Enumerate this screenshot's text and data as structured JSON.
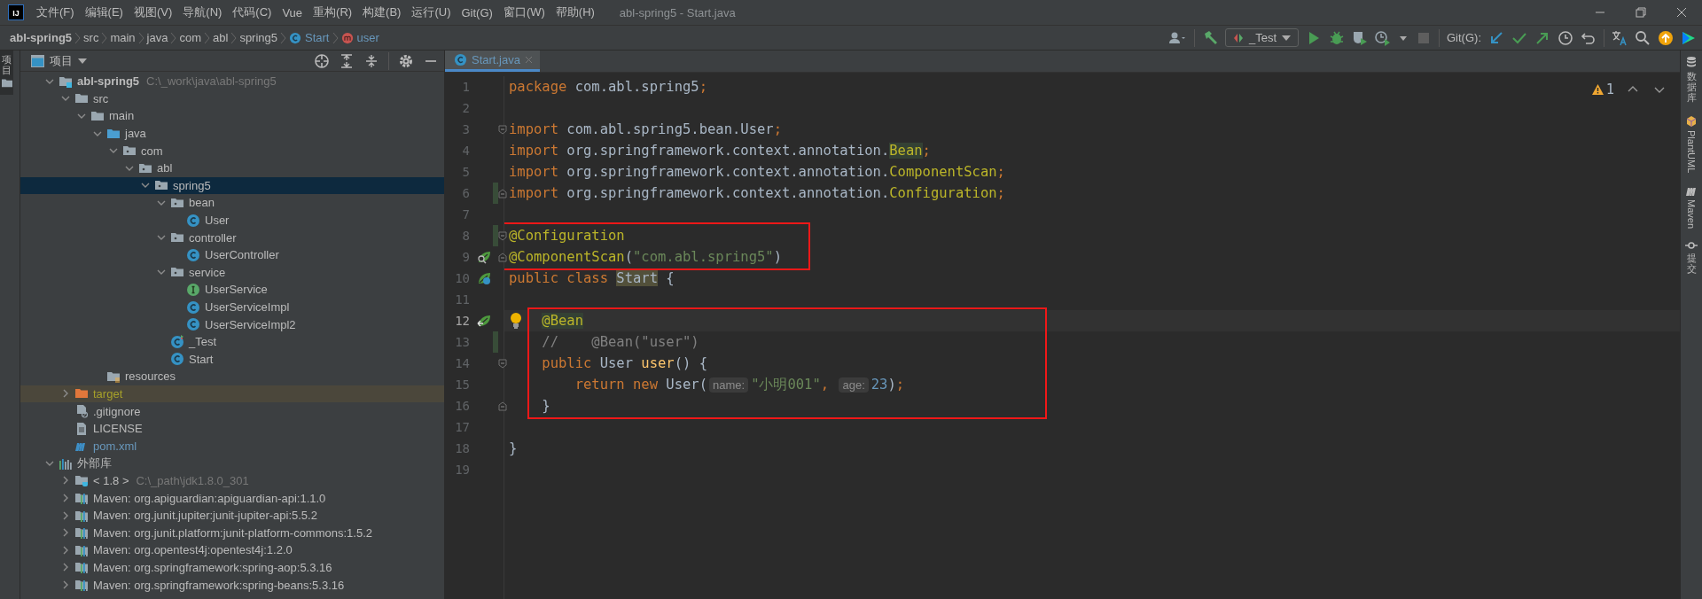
{
  "window": {
    "logo": "IJ",
    "title": "abl-spring5 - Start.java"
  },
  "menu": [
    "文件(F)",
    "编辑(E)",
    "视图(V)",
    "导航(N)",
    "代码(C)",
    "Vue",
    "重构(R)",
    "构建(B)",
    "运行(U)",
    "Git(G)",
    "窗口(W)",
    "帮助(H)"
  ],
  "breadcrumbs": [
    {
      "label": "abl-spring5",
      "kind": "project"
    },
    {
      "label": "src",
      "kind": "folder"
    },
    {
      "label": "main",
      "kind": "folder"
    },
    {
      "label": "java",
      "kind": "folder"
    },
    {
      "label": "com",
      "kind": "folder"
    },
    {
      "label": "abl",
      "kind": "folder"
    },
    {
      "label": "spring5",
      "kind": "folder"
    },
    {
      "label": "Start",
      "kind": "class"
    },
    {
      "label": "user",
      "kind": "method"
    }
  ],
  "toolbar": {
    "run_config": "_Test",
    "git_label": "Git(G):"
  },
  "left_stripe": [
    {
      "label": "项目",
      "selected": true
    }
  ],
  "project_panel": {
    "title": "项目",
    "items": [
      {
        "label": "abl-spring5",
        "hint": "C:\\_work\\java\\abl-spring5",
        "kind": "module",
        "expanded": true,
        "selected": false,
        "children": [
          {
            "label": "src",
            "kind": "folder",
            "expanded": true,
            "selected": false,
            "children": [
              {
                "label": "main",
                "kind": "folder",
                "expanded": true,
                "selected": false,
                "children": [
                  {
                    "label": "java",
                    "kind": "source-folder",
                    "expanded": true,
                    "selected": false,
                    "children": [
                      {
                        "label": "com",
                        "kind": "package",
                        "expanded": true,
                        "selected": false,
                        "children": [
                          {
                            "label": "abl",
                            "kind": "package",
                            "expanded": true,
                            "selected": false,
                            "children": [
                              {
                                "label": "spring5",
                                "kind": "package",
                                "expanded": true,
                                "selected": true,
                                "children": [
                                  {
                                    "label": "bean",
                                    "kind": "package",
                                    "expanded": true,
                                    "selected": false,
                                    "children": [
                                      {
                                        "label": "User",
                                        "kind": "class",
                                        "selected": false
                                      }
                                    ]
                                  },
                                  {
                                    "label": "controller",
                                    "kind": "package",
                                    "expanded": true,
                                    "selected": false,
                                    "children": [
                                      {
                                        "label": "UserController",
                                        "kind": "class",
                                        "selected": false
                                      }
                                    ]
                                  },
                                  {
                                    "label": "service",
                                    "kind": "package",
                                    "expanded": true,
                                    "selected": false,
                                    "children": [
                                      {
                                        "label": "UserService",
                                        "kind": "interface",
                                        "selected": false
                                      },
                                      {
                                        "label": "UserServiceImpl",
                                        "kind": "class",
                                        "selected": false
                                      },
                                      {
                                        "label": "UserServiceImpl2",
                                        "kind": "class",
                                        "selected": false
                                      }
                                    ]
                                  },
                                  {
                                    "label": "_Test",
                                    "kind": "test-class",
                                    "selected": false
                                  },
                                  {
                                    "label": "Start",
                                    "kind": "class",
                                    "selected": false
                                  }
                                ]
                              }
                            ]
                          }
                        ]
                      }
                    ]
                  },
                  {
                    "label": "resources",
                    "kind": "resources",
                    "selected": false
                  }
                ]
              }
            ]
          },
          {
            "label": "target",
            "kind": "excluded",
            "expanded": false,
            "selected": false
          },
          {
            "label": ".gitignore",
            "kind": "ignore-file",
            "selected": false
          },
          {
            "label": "LICENSE",
            "kind": "text-file",
            "selected": false
          },
          {
            "label": "pom.xml",
            "kind": "maven-file",
            "selected": false
          }
        ]
      },
      {
        "label": "外部库",
        "kind": "libraries",
        "expanded": true,
        "selected": false,
        "children": [
          {
            "label": "< 1.8 >",
            "hint": "C:\\_path\\jdk1.8.0_301",
            "kind": "jdk",
            "expanded": false,
            "selected": false
          },
          {
            "label": "Maven: org.apiguardian:apiguardian-api:1.1.0",
            "kind": "library",
            "expanded": false,
            "selected": false
          },
          {
            "label": "Maven: org.junit.jupiter:junit-jupiter-api:5.5.2",
            "kind": "library",
            "expanded": false,
            "selected": false
          },
          {
            "label": "Maven: org.junit.platform:junit-platform-commons:1.5.2",
            "kind": "library",
            "expanded": false,
            "selected": false
          },
          {
            "label": "Maven: org.opentest4j:opentest4j:1.2.0",
            "kind": "library",
            "expanded": false,
            "selected": false
          },
          {
            "label": "Maven: org.springframework:spring-aop:5.3.16",
            "kind": "library",
            "expanded": false,
            "selected": false
          },
          {
            "label": "Maven: org.springframework:spring-beans:5.3.16",
            "kind": "library",
            "expanded": false,
            "selected": false
          }
        ]
      }
    ]
  },
  "editor": {
    "tabs": [
      {
        "label": "Start.java",
        "selected": true
      }
    ],
    "warnings": "1",
    "blocks": [
      {
        "boxed": false,
        "lines": [
          {
            "number": "1",
            "current": false,
            "bulb": false,
            "tokens": [
              {
                "text": "package ",
                "kind": "kw"
              },
              {
                "text": "com.abl.spring5",
                "kind": "plain"
              },
              {
                "text": ";",
                "kind": "kw"
              }
            ]
          },
          {
            "number": "2",
            "current": false,
            "bulb": false
          },
          {
            "number": "3",
            "current": false,
            "bulb": false,
            "fold": {
              "kind": "start"
            },
            "tokens": [
              {
                "text": "import ",
                "kind": "kw"
              },
              {
                "text": "com.abl.spring5.bean.User",
                "kind": "plain"
              },
              {
                "text": ";",
                "kind": "kw"
              }
            ]
          },
          {
            "number": "4",
            "current": false,
            "bulb": false,
            "tokens": [
              {
                "text": "import ",
                "kind": "kw"
              },
              {
                "text": "org.springframework.context.annotation.",
                "kind": "plain"
              },
              {
                "text": "Bean",
                "kind": "ann",
                "highlighted": true
              },
              {
                "text": ";",
                "kind": "kw"
              }
            ]
          },
          {
            "number": "5",
            "current": false,
            "bulb": false,
            "tokens": [
              {
                "text": "import ",
                "kind": "kw"
              },
              {
                "text": "org.springframework.context.annotation.",
                "kind": "plain"
              },
              {
                "text": "ComponentScan",
                "kind": "ann"
              },
              {
                "text": ";",
                "kind": "kw"
              }
            ]
          },
          {
            "number": "6",
            "current": false,
            "bulb": false,
            "changed": true,
            "fold": {
              "kind": "end"
            },
            "tokens": [
              {
                "text": "import ",
                "kind": "kw"
              },
              {
                "text": "org.springframework.context.annotation.",
                "kind": "plain"
              },
              {
                "text": "Configuration",
                "kind": "ann"
              },
              {
                "text": ";",
                "kind": "kw"
              }
            ]
          },
          {
            "number": "7",
            "current": false,
            "bulb": false
          }
        ]
      },
      {
        "boxed": true,
        "lines": [
          {
            "number": "8",
            "current": false,
            "bulb": false,
            "changed": true,
            "fold": {
              "kind": "start"
            },
            "tokens": [
              {
                "text": "@Configuration",
                "kind": "ann"
              }
            ]
          },
          {
            "number": "9",
            "current": false,
            "bulb": false,
            "gutter_icon": {
              "kind": "bean-search"
            },
            "fold": {
              "kind": "end"
            },
            "tokens": [
              {
                "text": "@ComponentScan",
                "kind": "ann"
              },
              {
                "text": "(",
                "kind": "plain"
              },
              {
                "text": "\"com.abl.spring5\"",
                "kind": "str"
              },
              {
                "text": ")",
                "kind": "plain"
              }
            ]
          }
        ]
      },
      {
        "boxed": false,
        "lines": [
          {
            "number": "10",
            "current": false,
            "bulb": false,
            "gutter_icon": {
              "kind": "bean-class"
            },
            "tokens": [
              {
                "text": "public class ",
                "kind": "kw"
              },
              {
                "text": "Start",
                "kind": "plain",
                "highlighted": true
              },
              {
                "text": " {",
                "kind": "plain"
              }
            ]
          },
          {
            "number": "11",
            "current": false,
            "bulb": false
          }
        ]
      },
      {
        "boxed": true,
        "lines": [
          {
            "number": "12",
            "current": true,
            "bulb": true,
            "gutter_icon": {
              "kind": "bean-method"
            },
            "tokens": [
              {
                "text": "    @Bean",
                "kind": "ann",
                "highlighted": true
              }
            ]
          },
          {
            "number": "13",
            "current": false,
            "bulb": false,
            "changed": true,
            "tokens": [
              {
                "text": "    //    @Bean(\"user\")",
                "kind": "cmt"
              }
            ]
          },
          {
            "number": "14",
            "current": false,
            "bulb": false,
            "fold": {
              "kind": "start"
            },
            "tokens": [
              {
                "text": "    public ",
                "kind": "kw"
              },
              {
                "text": "User ",
                "kind": "plain"
              },
              {
                "text": "user",
                "kind": "fn"
              },
              {
                "text": "() {",
                "kind": "plain"
              }
            ]
          },
          {
            "number": "15",
            "current": false,
            "bulb": false,
            "tokens": [
              {
                "text": "        return new ",
                "kind": "kw"
              },
              {
                "text": "User(",
                "kind": "plain"
              },
              {
                "text": "name:",
                "kind": "hint"
              },
              {
                "text": "\"小明001\"",
                "kind": "str"
              },
              {
                "text": ", ",
                "kind": "kw"
              },
              {
                "text": "age:",
                "kind": "hint"
              },
              {
                "text": "23",
                "kind": "num"
              },
              {
                "text": ")",
                "kind": "plain"
              },
              {
                "text": ";",
                "kind": "kw"
              }
            ]
          },
          {
            "number": "16",
            "current": false,
            "bulb": false,
            "fold": {
              "kind": "end"
            },
            "tokens": [
              {
                "text": "    }",
                "kind": "plain"
              }
            ]
          }
        ]
      },
      {
        "boxed": false,
        "lines": [
          {
            "number": "17",
            "current": false,
            "bulb": false
          },
          {
            "number": "18",
            "current": false,
            "bulb": false,
            "tokens": [
              {
                "text": "}",
                "kind": "plain"
              }
            ]
          },
          {
            "number": "19",
            "current": false,
            "bulb": false
          }
        ]
      }
    ]
  },
  "right_stripe": [
    {
      "label": "数据库",
      "kind": "database"
    },
    {
      "label": "PlantUML",
      "kind": "plantuml"
    },
    {
      "label": "Maven",
      "kind": "maven"
    },
    {
      "label": "提交",
      "kind": "commit"
    }
  ]
}
